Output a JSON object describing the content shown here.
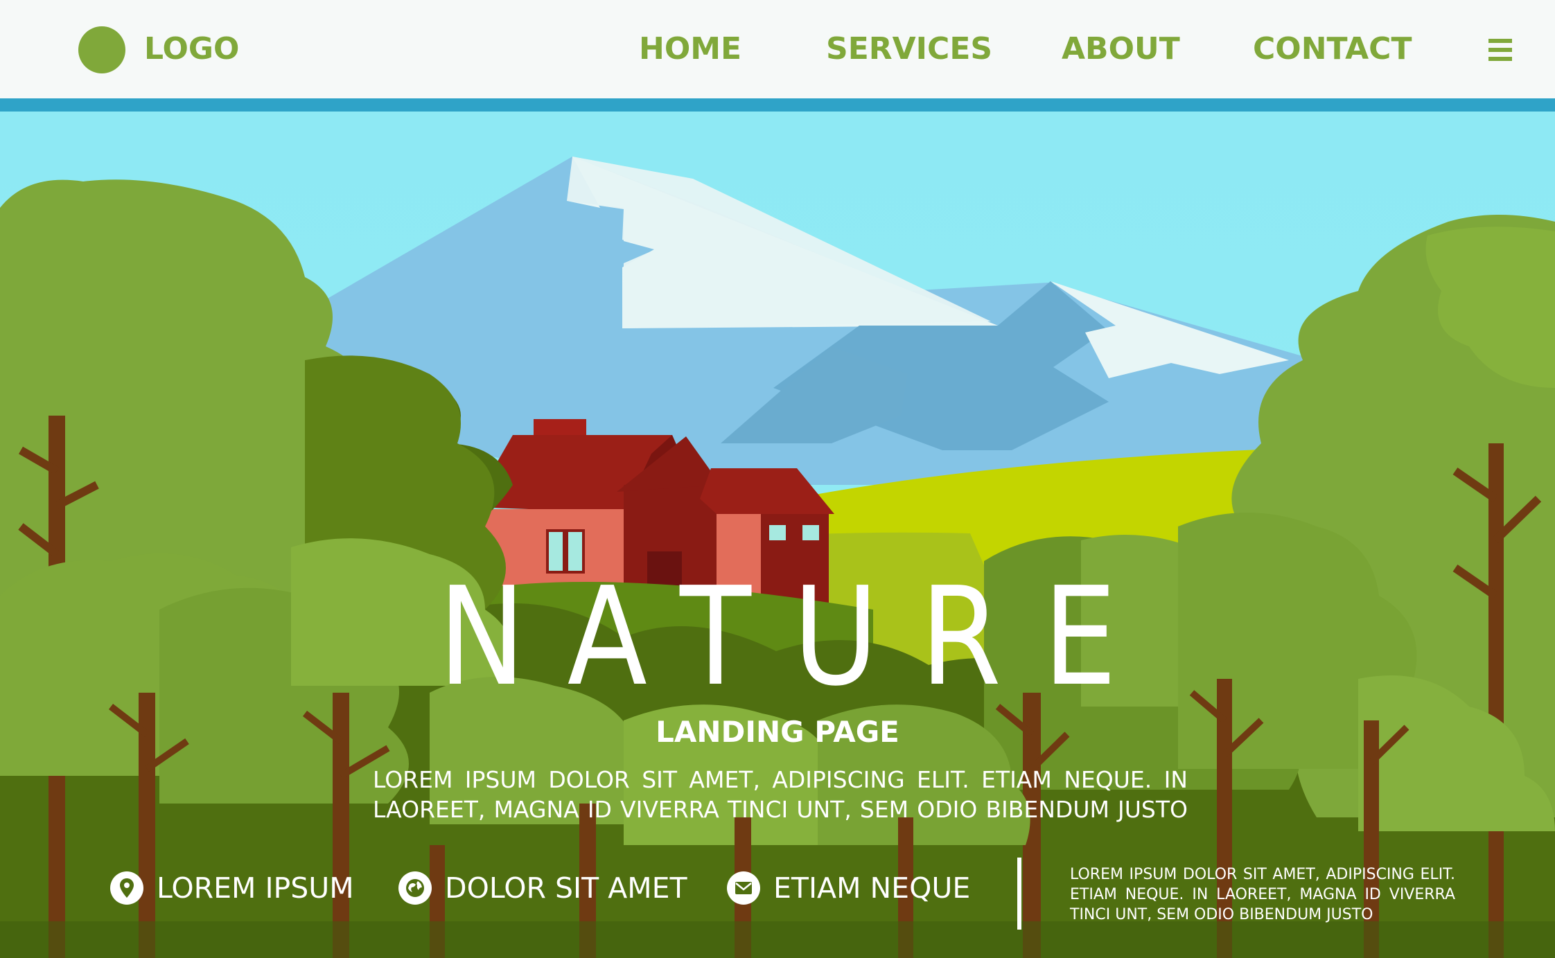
{
  "header": {
    "logo_text": "LOGO",
    "nav": [
      "HOME",
      "SERVICES",
      "ABOUT",
      "CONTACT"
    ],
    "menu_icon": "hamburger-menu-icon"
  },
  "hero": {
    "title": "NATURE",
    "subtitle": "LANDING PAGE",
    "body_lines": [
      "LOREM IPSUM DOLOR SIT AMET, ADIPISCING ELIT. ETIAM NEQUE. IN",
      "LAOREET, MAGNA ID VIVERRA TINCI UNT, SEM ODIO BIBENDUM JUSTO"
    ]
  },
  "contacts": [
    {
      "icon": "location-pin-icon",
      "label": "LOREM IPSUM"
    },
    {
      "icon": "globe-icon",
      "label": "DOLOR SIT AMET"
    },
    {
      "icon": "mail-icon",
      "label": "ETIAM NEQUE"
    }
  ],
  "side_note_lines": [
    "LOREM IPSUM DOLOR SIT AMET, ADIPISCING ELIT.",
    "ETIAM NEQUE. IN LAOREET, MAGNA ID VIVERRA",
    "TINCI UNT, SEM ODIO BIBENDUM JUSTO"
  ],
  "colors": {
    "brand_green": "#80a83a",
    "header_bg": "#f6f9f8",
    "header_accent": "#2fa3c8",
    "sky": "#8eecf3",
    "mountain": "#84c4e6",
    "meadow": "#c3d500",
    "house_roof": "#9b1f17",
    "house_wall": "#e26d5a"
  }
}
